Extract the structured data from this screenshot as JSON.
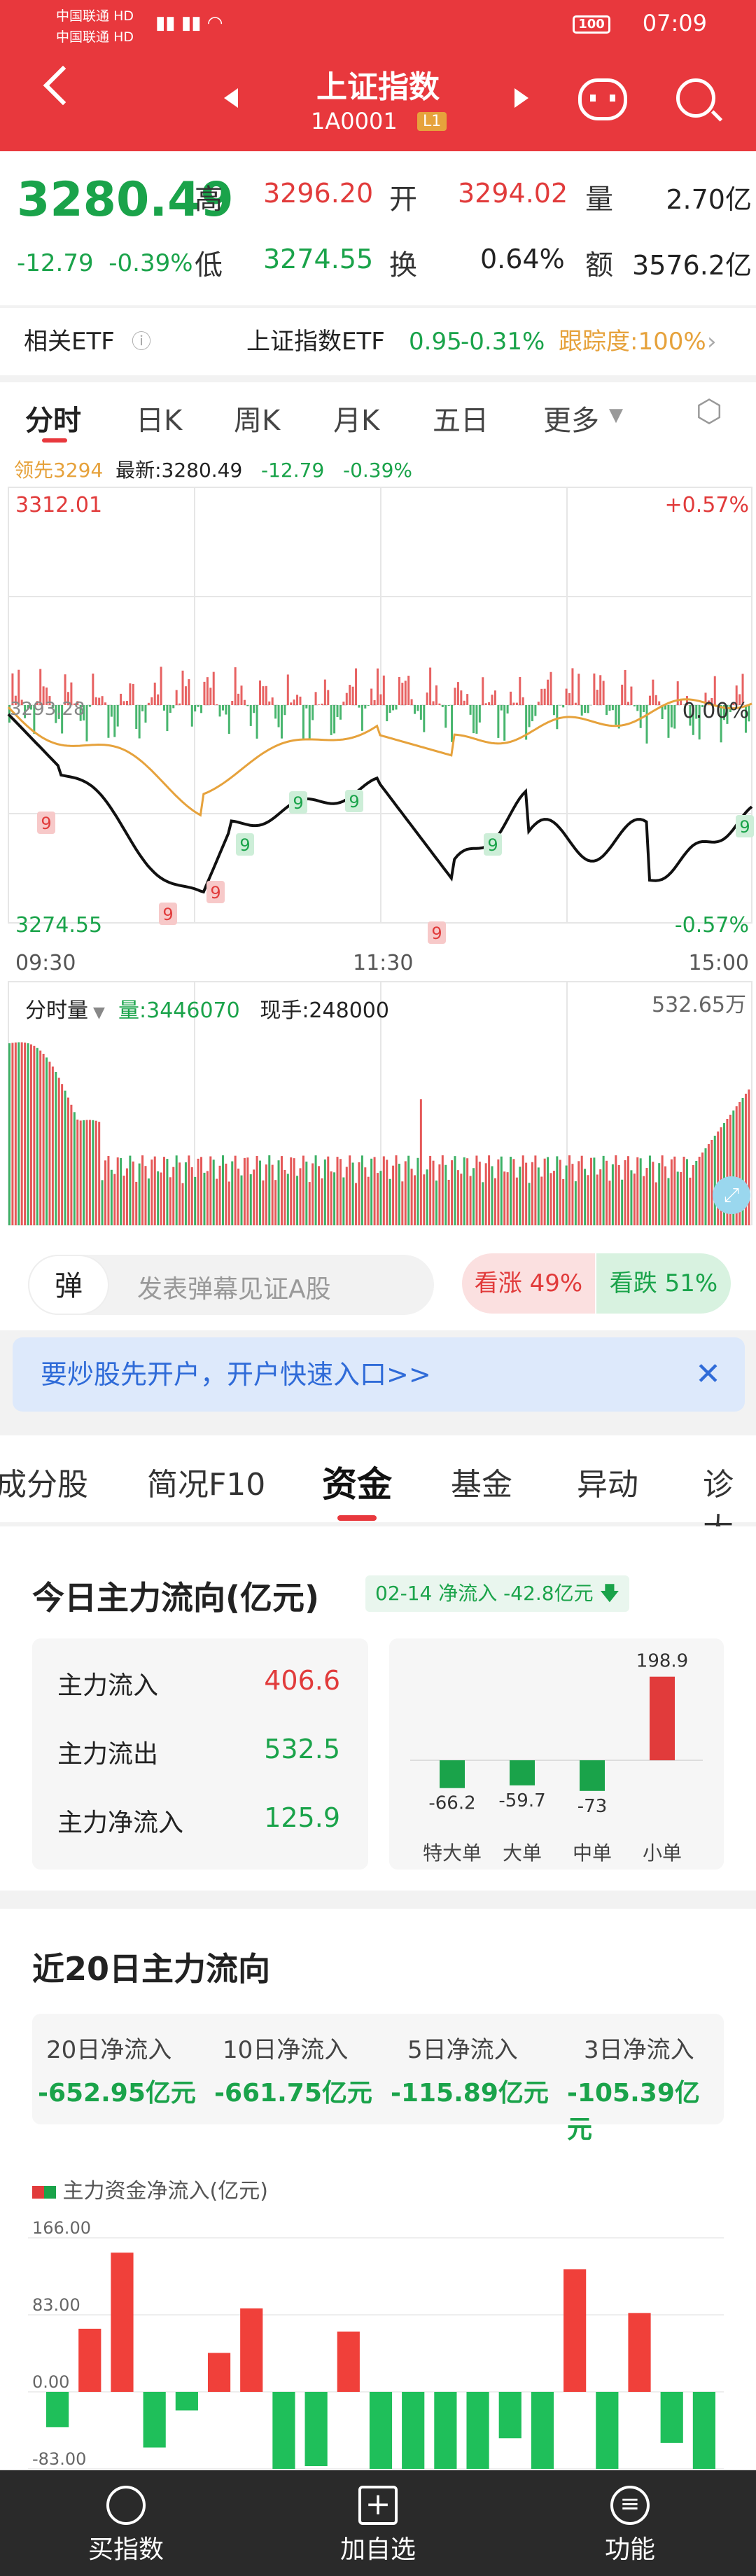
{
  "status_bar": {
    "carrier1": "中国联通",
    "carrier2": "中国联通",
    "hd": "HD",
    "battery": "100",
    "time": "07:09"
  },
  "header": {
    "title": "上证指数",
    "code": "1A0001",
    "level": "L1"
  },
  "quote": {
    "price": "3280.49",
    "change": "-12.79",
    "change_pct": "-0.39%",
    "labels": {
      "high": "高",
      "open": "开",
      "volume": "量",
      "low": "低",
      "turnover": "换",
      "amount": "额"
    },
    "high": "3296.20",
    "open": "3294.02",
    "volume": "2.70亿",
    "low": "3274.55",
    "turnover_rate": "0.64%",
    "amount": "3576.2亿"
  },
  "etf": {
    "label": "相关ETF",
    "name": "上证指数ETF",
    "price": "0.95",
    "pct": "-0.31%",
    "tracking": "跟踪度:100%"
  },
  "tabs": [
    {
      "label": "分时"
    },
    {
      "label": "日K"
    },
    {
      "label": "周K"
    },
    {
      "label": "月K"
    },
    {
      "label": "五日"
    },
    {
      "label": "更多"
    }
  ],
  "chart": {
    "lead": "领先3294",
    "latest": "最新:3280.49",
    "change": "-12.79",
    "pct": "-0.39%",
    "top_price": "3312.01",
    "top_pct": "+0.57%",
    "bottom_price": "3274.55",
    "bottom_pct": "-0.57%",
    "mid_price": "3293.28",
    "mid_pct": "0.00%",
    "time_start": "09:30",
    "time_mid": "11:30",
    "time_end": "15:00",
    "volume_label": "分时量",
    "volume": "量:3446070",
    "current_hand": "现手:248000",
    "vol_max": "532.65万",
    "signals": [
      "9",
      "9",
      "9",
      "9",
      "9",
      "9",
      "9",
      "9",
      "9"
    ]
  },
  "bullet": {
    "icon_text": "弹",
    "placeholder": "发表弹幕见证A股",
    "up": "看涨 49%",
    "down": "看跌 51%"
  },
  "banner": {
    "text": "要炒股先开户，开户快速入口>>"
  },
  "section_tabs": [
    {
      "label": "成分股"
    },
    {
      "label": "简况F10"
    },
    {
      "label": "资金"
    },
    {
      "label": "基金"
    },
    {
      "label": "异动"
    },
    {
      "label": "诊大"
    }
  ],
  "flow": {
    "title": "今日主力流向(亿元)",
    "tag": "02-14 净流入 -42.8亿元",
    "rows": [
      {
        "label": "主力流入",
        "value": "406.6"
      },
      {
        "label": "主力流出",
        "value": "532.5"
      },
      {
        "label": "主力净流入",
        "value": "125.9"
      }
    ]
  },
  "chart_data": [
    {
      "type": "bar",
      "categories": [
        "特大单",
        "大单",
        "中单",
        "小单"
      ],
      "values": [
        -66.2,
        -59.7,
        -73,
        198.9
      ]
    },
    {
      "type": "bar",
      "title": "主力资金净流入(亿元)",
      "ylim": [
        -83,
        166
      ],
      "yticks": [
        "166.00",
        "83.00",
        "0.00",
        "-83.00"
      ],
      "values": [
        -38,
        68,
        150,
        -60,
        -20,
        42,
        90,
        -180,
        -80,
        65,
        -150,
        -140,
        -150,
        -140,
        -50,
        -200,
        132,
        -120,
        85,
        -55,
        -140
      ]
    }
  ],
  "flow20": {
    "title": "近20日主力流向",
    "items": [
      {
        "label": "20日净流入",
        "value": "-652.95亿元"
      },
      {
        "label": "10日净流入",
        "value": "-661.75亿元"
      },
      {
        "label": "5日净流入",
        "value": "-115.89亿元"
      },
      {
        "label": "3日净流入",
        "value": "-105.39亿元"
      }
    ]
  },
  "footer": [
    {
      "label": "买指数"
    },
    {
      "label": "加自选"
    },
    {
      "label": "功能"
    }
  ],
  "colors": {
    "brand": "#e8383d",
    "up": "#e13b3b",
    "down": "#1aa34a",
    "accent": "#e6a23c"
  }
}
